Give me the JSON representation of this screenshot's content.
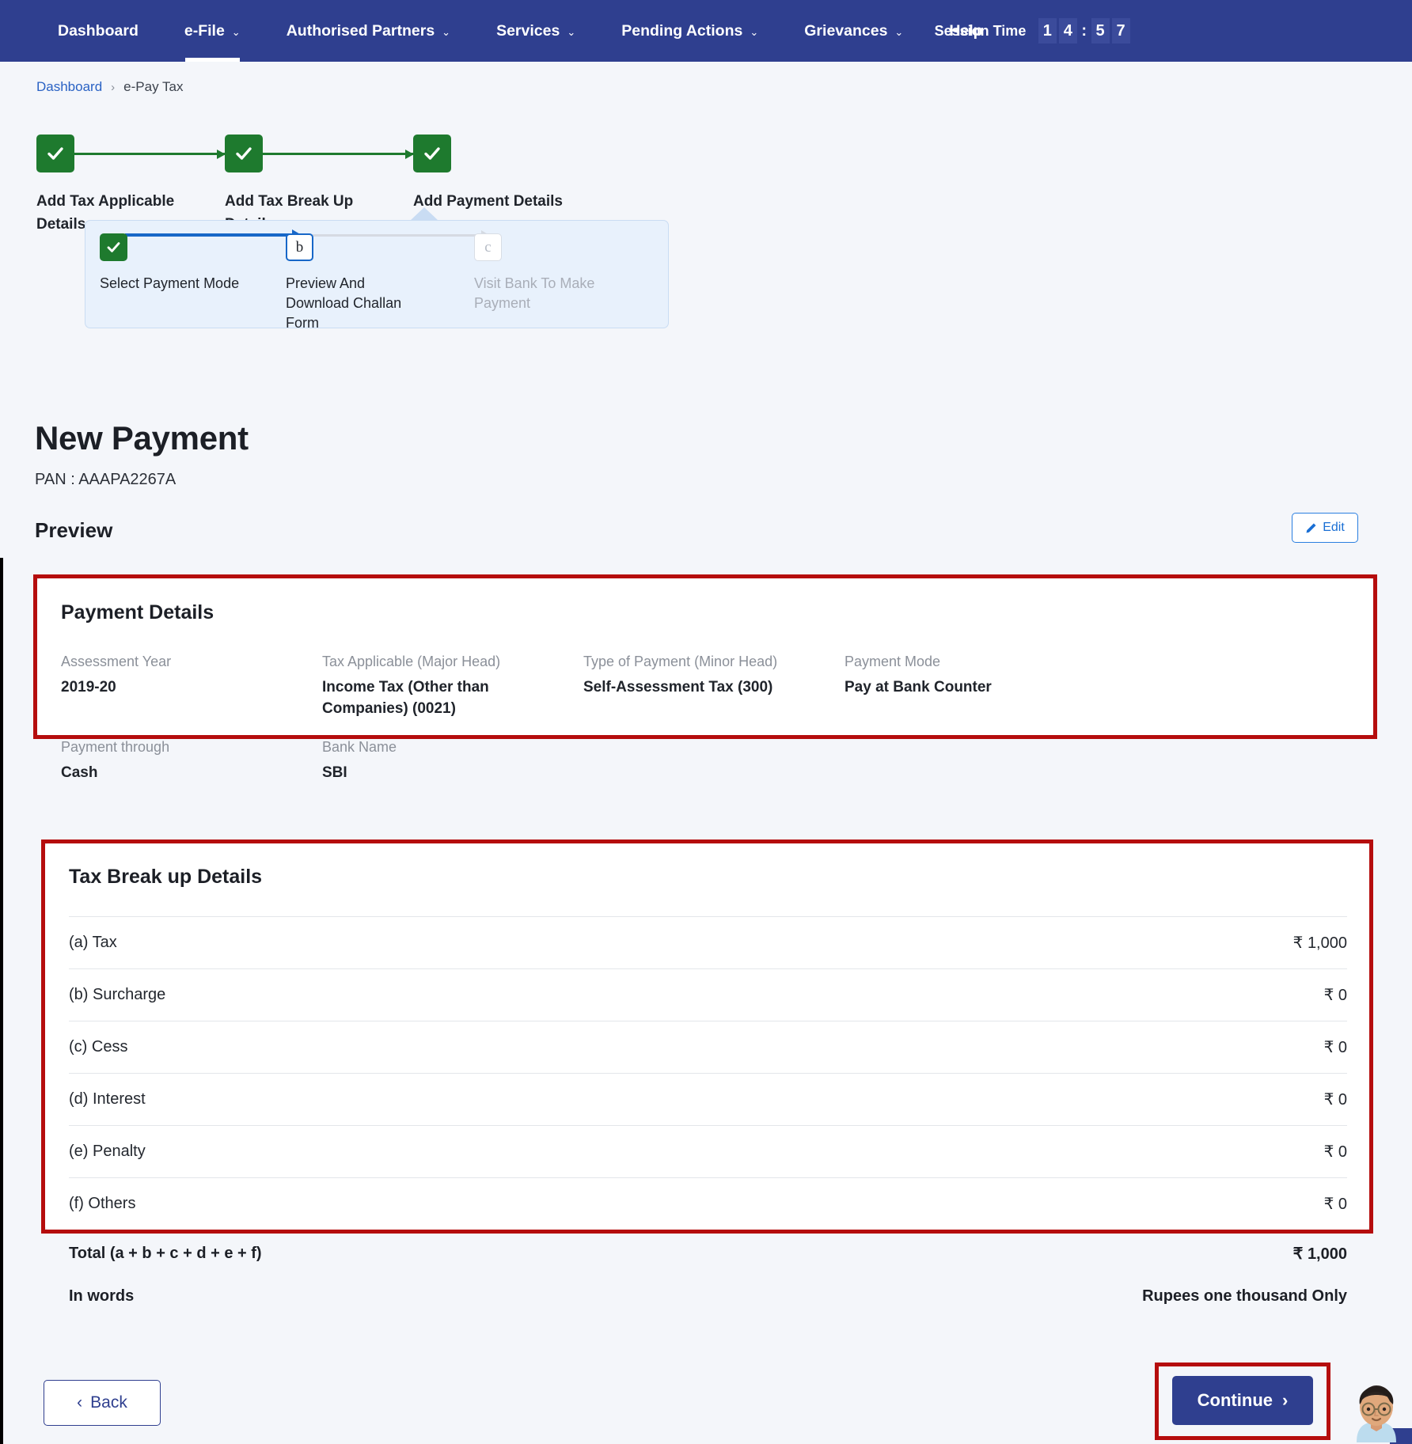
{
  "theme": {
    "nav_bg": "#2f3f8f",
    "page_bg": "#f4f6fa",
    "accent_blue": "#1767c8",
    "done_green": "#1e7a2e",
    "annotation_red": "#b50d0d",
    "link_blue": "#2a62c4"
  },
  "topnav": {
    "items": [
      {
        "label": "Dashboard",
        "caret": "",
        "active": false
      },
      {
        "label": "e-File",
        "caret": "⌄",
        "active": true
      },
      {
        "label": "Authorised Partners",
        "caret": "⌄",
        "active": false
      },
      {
        "label": "Services",
        "caret": "⌄",
        "active": false
      },
      {
        "label": "Pending Actions",
        "caret": "⌄",
        "active": false
      },
      {
        "label": "Grievances",
        "caret": "⌄",
        "active": false
      },
      {
        "label": "Help",
        "caret": "",
        "active": false
      }
    ],
    "session": {
      "label": "Session Time",
      "d1": "1",
      "d2": "4",
      "colon": ":",
      "d3": "5",
      "d4": "7",
      "full": "14:57"
    }
  },
  "breadcrumb": {
    "root": "Dashboard",
    "separator": "›",
    "current": "e-Pay Tax"
  },
  "stepper": {
    "steps": [
      {
        "label": "Add Tax Applicable Details",
        "state": "done",
        "glyph": "✔"
      },
      {
        "label": "Add Tax Break Up Details",
        "state": "done",
        "glyph": "✔"
      },
      {
        "label": "Add Payment Details",
        "state": "done",
        "glyph": "✔"
      }
    ]
  },
  "substepper": {
    "steps": [
      {
        "marker": "✔",
        "label": "Select Payment Mode",
        "state": "done"
      },
      {
        "marker": "b",
        "label": "Preview And Download Challan Form",
        "state": "current"
      },
      {
        "marker": "c",
        "label": "Visit Bank To Make Payment",
        "state": "todo"
      }
    ]
  },
  "page": {
    "title": "New Payment",
    "pan": "PAN : AAAPA2267A",
    "preview_heading": "Preview",
    "edit_label": "Edit"
  },
  "payment_details": {
    "title": "Payment Details",
    "fields_row1": [
      {
        "label": "Assessment Year",
        "value": "2019-20"
      },
      {
        "label": "Tax Applicable (Major Head)",
        "value": "Income Tax (Other than Companies) (0021)"
      },
      {
        "label": "Type of Payment (Minor Head)",
        "value": "Self-Assessment Tax (300)"
      },
      {
        "label": "Payment Mode",
        "value": "Pay at Bank Counter"
      }
    ],
    "fields_row2": [
      {
        "label": "Payment through",
        "value": "Cash"
      },
      {
        "label": "Bank Name",
        "value": "SBI"
      }
    ]
  },
  "tax_breakup": {
    "title": "Tax Break up Details",
    "rows": [
      {
        "label": "(a) Tax",
        "amount": "₹ 1,000"
      },
      {
        "label": "(b) Surcharge",
        "amount": "₹ 0"
      },
      {
        "label": "(c) Cess",
        "amount": "₹ 0"
      },
      {
        "label": "(d) Interest",
        "amount": "₹ 0"
      },
      {
        "label": "(e) Penalty",
        "amount": "₹ 0"
      },
      {
        "label": "(f) Others",
        "amount": "₹ 0"
      }
    ],
    "total": {
      "label": "Total (a + b + c + d + e + f)",
      "amount": "₹ 1,000"
    },
    "in_words": {
      "label": "In words",
      "value": "Rupees one thousand Only"
    }
  },
  "footer": {
    "back_label": "Back",
    "back_chevron": "‹",
    "continue_label": "Continue",
    "continue_chevron": "›"
  }
}
